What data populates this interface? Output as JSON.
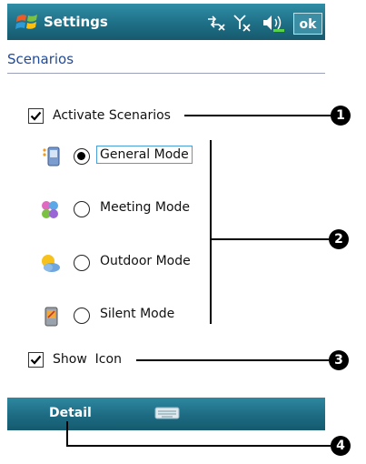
{
  "titlebar": {
    "title": "Settings",
    "ok_label": "ok"
  },
  "header": {
    "page_title": "Scenarios"
  },
  "activate": {
    "label": "Activate Scenarios",
    "checked": true
  },
  "modes": [
    {
      "label": "General Mode",
      "selected": true,
      "icon": "general-mode-icon"
    },
    {
      "label": "Meeting Mode",
      "selected": false,
      "icon": "meeting-mode-icon"
    },
    {
      "label": "Outdoor Mode",
      "selected": false,
      "icon": "outdoor-mode-icon"
    },
    {
      "label": "Silent Mode",
      "selected": false,
      "icon": "silent-mode-icon"
    }
  ],
  "show_icon": {
    "label": "Show  Icon",
    "checked": true
  },
  "menubar": {
    "detail_label": "Detail"
  },
  "callouts": [
    "1",
    "2",
    "3",
    "4"
  ],
  "colors": {
    "titlebar": "#1e6f86",
    "header_text": "#1f4a9b",
    "focus": "#4a9fd8"
  }
}
